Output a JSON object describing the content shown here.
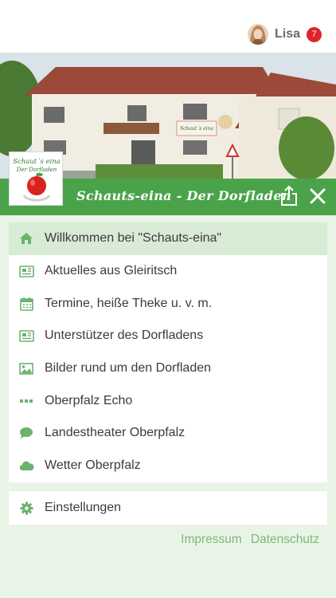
{
  "user": {
    "name": "Lisa",
    "notification_count": "7"
  },
  "logo": {
    "line1": "Schaut´s eina",
    "line2": "Der Dorfladen"
  },
  "header": {
    "title": "Schauts-eina - Der Dorfladen"
  },
  "hero": {
    "building_sign": "Schaut´s eina"
  },
  "menu": {
    "items": [
      {
        "label": "Willkommen bei \"Schauts-eina\"",
        "icon": "home-icon"
      },
      {
        "label": "Aktuelles aus Gleiritsch",
        "icon": "newspaper-icon"
      },
      {
        "label": "Termine, heiße Theke u. v. m.",
        "icon": "calendar-icon"
      },
      {
        "label": "Unterstützer des Dorfladens",
        "icon": "newspaper-icon"
      },
      {
        "label": "Bilder rund um den Dorfladen",
        "icon": "image-icon"
      },
      {
        "label": "Oberpfalz Echo",
        "icon": "ellipsis-icon"
      },
      {
        "label": "Landestheater Oberpfalz",
        "icon": "speech-bubble-icon"
      },
      {
        "label": "Wetter Oberpfalz",
        "icon": "cloud-icon"
      }
    ],
    "settings_label": "Einstellungen"
  },
  "footer": {
    "impressum": "Impressum",
    "datenschutz": "Datenschutz"
  },
  "colors": {
    "brand_green": "#4aa34a",
    "icon_green": "#6bb36a",
    "active_bg": "#d8ebd5",
    "page_bg": "#e9f4e7",
    "badge_red": "#e0242a",
    "link_green": "#7cb87a"
  }
}
